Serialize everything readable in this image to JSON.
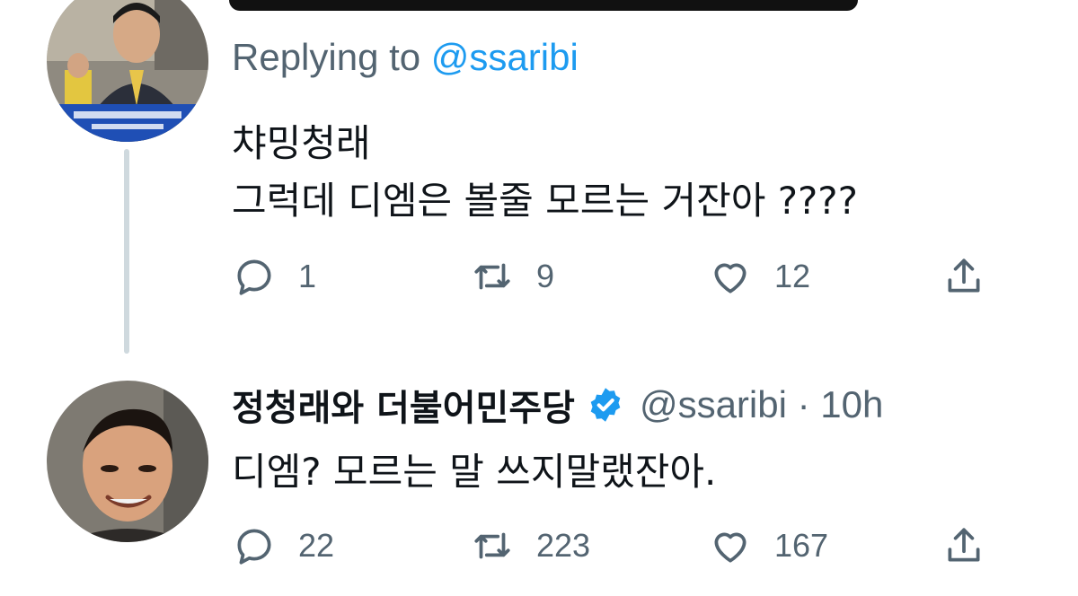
{
  "tweet1": {
    "replying_prefix": "Replying to",
    "replying_handle": "@ssaribi",
    "line1": "챠밍청래",
    "line2": "그럭데 디엠은 볼줄 모르는 거잔아 ????",
    "reply_count": "1",
    "retweet_count": "9",
    "like_count": "12"
  },
  "tweet2": {
    "display_name": "정청래와 더불어민주당",
    "meta": "@ssaribi · 10h",
    "text": "디엠? 모르는 말 쓰지말랬잔아.",
    "reply_count": "22",
    "retweet_count": "223",
    "like_count": "167"
  },
  "colors": {
    "text": "#0f1419",
    "secondary": "#536471",
    "accent": "#1d9bf0",
    "thread_line": "#cfd9de"
  },
  "icons": [
    "reply-icon",
    "retweet-icon",
    "like-icon",
    "share-icon",
    "verified-badge-icon"
  ]
}
